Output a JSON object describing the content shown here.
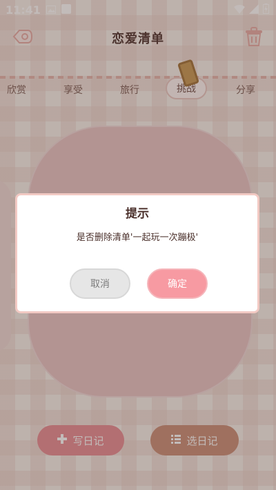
{
  "status": {
    "time": "11:41"
  },
  "header": {
    "title": "恋爱清单"
  },
  "tabs": [
    "欣赏",
    "享受",
    "旅行",
    "挑战",
    "分享"
  ],
  "bottom": {
    "write_label": "写日记",
    "choose_label": "选日记"
  },
  "dialog": {
    "title": "提示",
    "message": "是否删除清单'一起玩一次蹦极'",
    "cancel": "取消",
    "confirm": "确定"
  },
  "colors": {
    "accent": "#f79aa2",
    "title_text": "#4a2f2a",
    "dialog_border": "#f2c9c3"
  }
}
